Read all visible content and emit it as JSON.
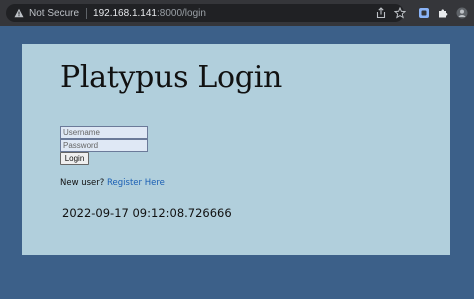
{
  "browser": {
    "security_label": "Not Secure",
    "url_host": "192.168.1.141",
    "url_rest": ":8000/login",
    "icons": [
      "warning-icon",
      "share-icon",
      "star-icon",
      "extension-badge-icon",
      "puzzle-icon",
      "profile-icon"
    ]
  },
  "page": {
    "title": "Platypus Login",
    "username_placeholder": "Username",
    "password_placeholder": "Password",
    "login_label": "Login",
    "new_user_text": "New user?",
    "register_link": "Register Here",
    "timestamp": "2022-09-17 09:12:08.726666"
  },
  "colors": {
    "page_background": "#3c6089",
    "panel_background": "#b1cfdc",
    "link": "#1a5fb4"
  }
}
